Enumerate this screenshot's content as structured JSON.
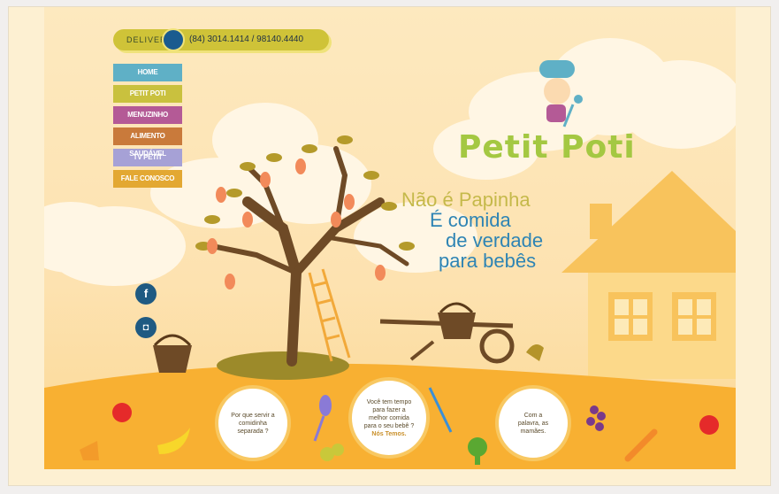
{
  "delivery": {
    "label": "DELIVERY",
    "phone": "(84) 3014.1414 / 98140.4440"
  },
  "menu": [
    {
      "label": "HOME",
      "color": "#5fb0c6"
    },
    {
      "label": "PETIT POTI",
      "color": "#c9c13e"
    },
    {
      "label": "MENUZINHO",
      "color": "#b45a96"
    },
    {
      "label": "ALIMENTO SAUDÁVEL",
      "color": "#c97a3b"
    },
    {
      "label": "TV PETIT",
      "color": "#a6a1d6"
    },
    {
      "label": "FALE CONOSCO",
      "color": "#e3a832"
    }
  ],
  "logo": "Petit Poti",
  "slogan": {
    "line1": "Não é Papinha",
    "line2": "É comida",
    "line3": "de verdade",
    "line4": "para bebês"
  },
  "social": {
    "facebook": "f",
    "instagram": "◘"
  },
  "bubbles": [
    {
      "text": "Por que servir a comidinha separada ?"
    },
    {
      "text": "Você tem tempo para fazer a melhor comida para o seu bebê ?",
      "link": "Nós Temos."
    },
    {
      "text": "Com a palavra, as mamães."
    }
  ],
  "colors": {
    "hill": "#f8b032",
    "brown": "#6e4a26"
  }
}
